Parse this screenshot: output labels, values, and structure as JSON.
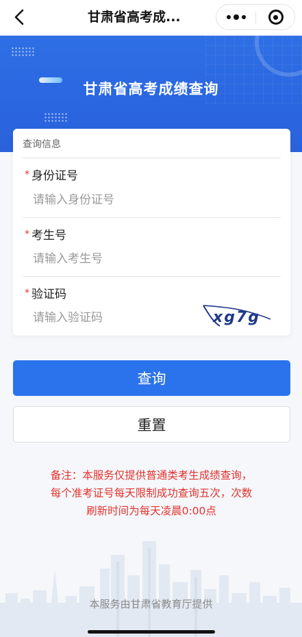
{
  "nav": {
    "title": "甘肃省高考成..."
  },
  "banner": {
    "title": "甘肃省高考成绩查询"
  },
  "form": {
    "header": "查询信息",
    "required_mark": "*",
    "fields": [
      {
        "label": "身份证号",
        "placeholder": "请输入身份证号",
        "value": ""
      },
      {
        "label": "考生号",
        "placeholder": "请输入考生号",
        "value": ""
      },
      {
        "label": "验证码",
        "placeholder": "请输入验证码",
        "value": ""
      }
    ],
    "captcha_text": "xg7g"
  },
  "buttons": {
    "query": "查询",
    "reset": "重置"
  },
  "note": {
    "line1": "备注：本服务仅提供普通类考生成绩查询，",
    "line2": "每个准考证号每天限制成功查询五次，次数",
    "line3": "刷新时间为每天凌晨0:00点"
  },
  "footer": {
    "text": "本服务由甘肃省教育厅提供"
  },
  "colors": {
    "primary": "#2b73ec",
    "banner": "#2f6fe4",
    "required": "#e3332f",
    "note": "#e3332f",
    "captcha": "#1f3a8a"
  },
  "icons": {
    "back": "chevron-left-icon",
    "more": "more-dots-icon",
    "close": "target-circle-icon"
  }
}
